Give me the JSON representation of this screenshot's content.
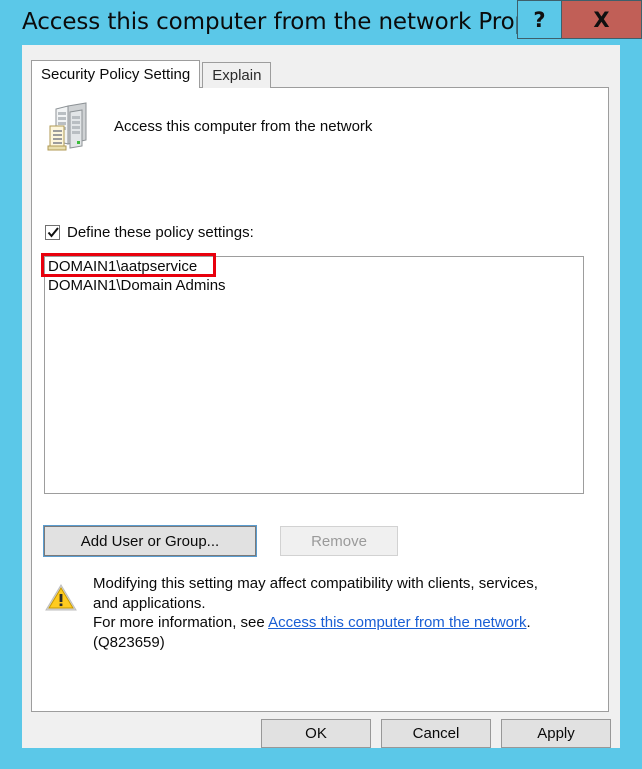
{
  "window": {
    "title": "Access this computer from the network Properties",
    "accent_color": "#5bc8e8",
    "close_color": "#c15f57"
  },
  "caption": {
    "help_label": "?",
    "close_label": "X"
  },
  "tabs": [
    {
      "label": "Security Policy Setting",
      "active": true
    },
    {
      "label": "Explain",
      "active": false
    }
  ],
  "policy": {
    "icon": "server-policy-icon",
    "name": "Access this computer from the network"
  },
  "define": {
    "label": "Define these policy settings:",
    "checked": true
  },
  "list": {
    "items": [
      {
        "label": "DOMAIN1\\aatpservice",
        "highlighted": true
      },
      {
        "label": "DOMAIN1\\Domain Admins",
        "highlighted": false
      }
    ],
    "highlight_color": "#e8000d"
  },
  "actions": {
    "add_label": "Add User or Group...",
    "remove_label": "Remove",
    "remove_enabled": false
  },
  "warning": {
    "icon": "warning-triangle-icon",
    "line1": "Modifying this setting may affect compatibility with clients, services,",
    "line2": "and applications.",
    "line3_prefix": "For more information, see ",
    "link_text": "Access this computer from the network",
    "line3_suffix": ".",
    "line4": "(Q823659)",
    "link_color": "#1a5fd4"
  },
  "footer": {
    "ok_label": "OK",
    "cancel_label": "Cancel",
    "apply_label": "Apply"
  }
}
